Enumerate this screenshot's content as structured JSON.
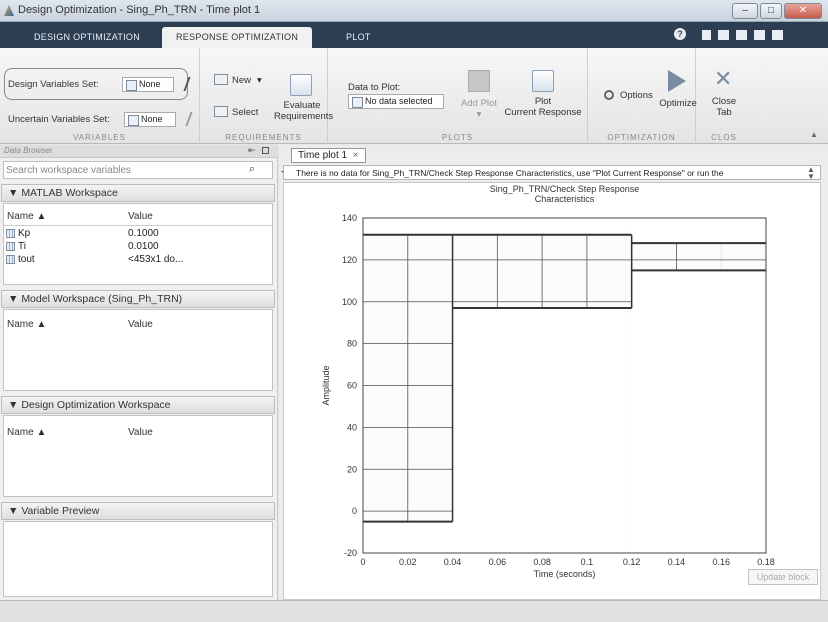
{
  "window": {
    "title": "Design Optimization - Sing_Ph_TRN - Time plot 1",
    "buttons": [
      "–",
      "□",
      "✕"
    ]
  },
  "tabs": [
    {
      "label": "DESIGN OPTIMIZATION"
    },
    {
      "label": "RESPONSE OPTIMIZATION"
    },
    {
      "label": "PLOT"
    }
  ],
  "ribbon": {
    "variables": {
      "design_label": "Design Variables Set:",
      "design_value": "None",
      "uncertain_label": "Uncertain Variables Set:",
      "uncertain_value": "None",
      "section": "VARIABLES"
    },
    "requirements": {
      "new": "New",
      "select": "Select",
      "evaluate": [
        "Evaluate",
        "Requirements"
      ],
      "section": "REQUIREMENTS"
    },
    "plots": {
      "data_label": "Data to Plot:",
      "data_value": "No data selected",
      "add_plot": "Add Plot",
      "plot_current": [
        "Plot",
        "Current Response"
      ],
      "section": "PLOTS"
    },
    "optimization": {
      "options": "Options",
      "optimize": "Optimize",
      "section": "OPTIMIZATION"
    },
    "close": {
      "label": [
        "Close",
        "Tab"
      ],
      "section": "CLOS"
    }
  },
  "left": {
    "browser_title": "Data Browser",
    "search_placeholder": "Search workspace variables",
    "matlab_ws": {
      "title": "MATLAB Workspace",
      "col_name": "Name ▲",
      "col_value": "Value",
      "rows": [
        {
          "name": "Kp",
          "value": "0.1000"
        },
        {
          "name": "Ti",
          "value": "0.0100"
        },
        {
          "name": "tout",
          "value": "<453x1 do..."
        }
      ]
    },
    "model_ws": {
      "title": "Model Workspace (Sing_Ph_TRN)",
      "col_name": "Name ▲",
      "col_value": "Value"
    },
    "design_ws": {
      "title": "Design Optimization Workspace",
      "col_name": "Name ▲",
      "col_value": "Value"
    },
    "preview": {
      "title": "Variable Preview"
    }
  },
  "plot": {
    "tab_label": "Time plot 1",
    "tab_close": "×",
    "warning": "There is no data for Sing_Ph_TRN/Check Step Response Characteristics, use \"Plot Current Response\" or run the",
    "update_block": "Update block"
  },
  "chart_data": {
    "type": "line",
    "title": [
      "Sing_Ph_TRN/Check Step Response",
      "Characteristics"
    ],
    "xlabel": "Time (seconds)",
    "ylabel": "Amplitude",
    "xlim": [
      0,
      0.18
    ],
    "ylim": [
      -20,
      140
    ],
    "xticks": [
      0,
      0.02,
      0.04,
      0.06,
      0.08,
      0.1,
      0.12,
      0.14,
      0.16,
      0.18
    ],
    "xticklabels": [
      "0",
      "0.02",
      "0.04",
      "0.06",
      "0.08",
      "0.1",
      "0.12",
      "0.14",
      "0.16",
      "0.18"
    ],
    "yticks": [
      -20,
      0,
      20,
      40,
      60,
      80,
      100,
      120,
      140
    ],
    "grid": true,
    "bounds": [
      {
        "name": "upper",
        "x": [
          0,
          0.12
        ],
        "y": [
          132,
          132
        ]
      },
      {
        "name": "upper",
        "x": [
          0.12,
          0.18
        ],
        "y": [
          128,
          128
        ]
      },
      {
        "name": "lower",
        "x": [
          0,
          0.04
        ],
        "y": [
          -5,
          -5
        ]
      },
      {
        "name": "lower",
        "x": [
          0.04,
          0.12
        ],
        "y": [
          97,
          97
        ]
      },
      {
        "name": "lower",
        "x": [
          0.12,
          0.18
        ],
        "y": [
          115,
          115
        ]
      }
    ],
    "edges": [
      {
        "x": [
          0.04,
          0.04
        ],
        "y": [
          -5,
          132
        ]
      },
      {
        "x": [
          0.12,
          0.12
        ],
        "y": [
          97,
          132
        ]
      }
    ],
    "inner_grid": {
      "x": [
        0.02,
        0.04,
        0.06,
        0.08,
        0.1,
        0.14
      ],
      "y": [
        0,
        20,
        40,
        60,
        80,
        100,
        120
      ]
    }
  },
  "colors": {
    "tabbar": "#2d3e52",
    "bound_fill": "#ffffff",
    "bound_line": "#333333"
  }
}
